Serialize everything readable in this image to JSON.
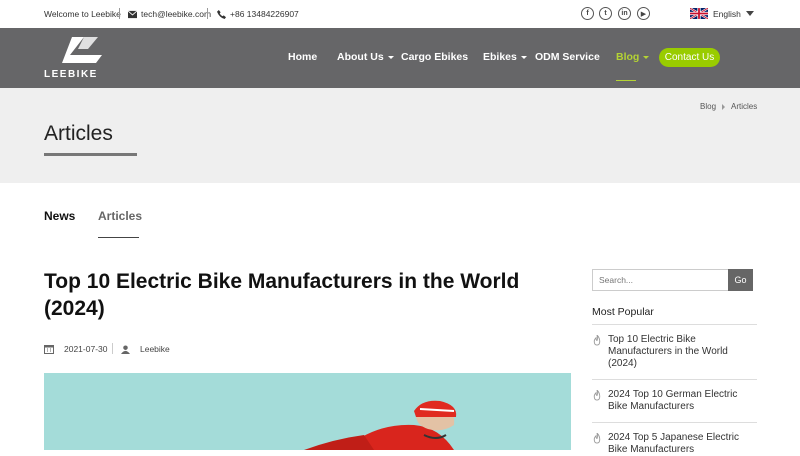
{
  "topbar": {
    "welcome": "Welcome to Leebike",
    "email": "tech@leebike.com",
    "phone": "+86 13484226907",
    "social": [
      {
        "icon": "facebook-icon",
        "glyph": "f"
      },
      {
        "icon": "twitter-icon",
        "glyph": "t"
      },
      {
        "icon": "linkedin-icon",
        "glyph": "in"
      },
      {
        "icon": "youtube-icon",
        "glyph": "▶"
      }
    ],
    "language": "English"
  },
  "header": {
    "logo_text": "LEEBIKE",
    "nav": [
      {
        "label": "Home",
        "dropdown": false
      },
      {
        "label": "About Us",
        "dropdown": true
      },
      {
        "label": "Cargo Ebikes",
        "dropdown": false
      },
      {
        "label": "Ebikes",
        "dropdown": true
      },
      {
        "label": "ODM Service",
        "dropdown": false
      },
      {
        "label": "Blog",
        "dropdown": true,
        "active": true
      }
    ],
    "contact_button": "Contact Us",
    "accent_color": "#99cc00"
  },
  "banner": {
    "title": "Articles",
    "breadcrumb": [
      "Blog",
      "Articles"
    ]
  },
  "tabs": [
    "News",
    "Articles"
  ],
  "article": {
    "title": "Top 10 Electric Bike Manufacturers in the World (2024)",
    "date": "2021-07-30",
    "author": "Leebike"
  },
  "sidebar": {
    "search_placeholder": "Search...",
    "search_button": "Go",
    "popular_heading": "Most Popular",
    "popular": [
      "Top 10 Electric Bike Manufacturers in the World (2024)",
      "2024 Top 10 German Electric Bike Manufacturers",
      "2024 Top 5 Japanese Electric Bike Manufacturers"
    ]
  }
}
